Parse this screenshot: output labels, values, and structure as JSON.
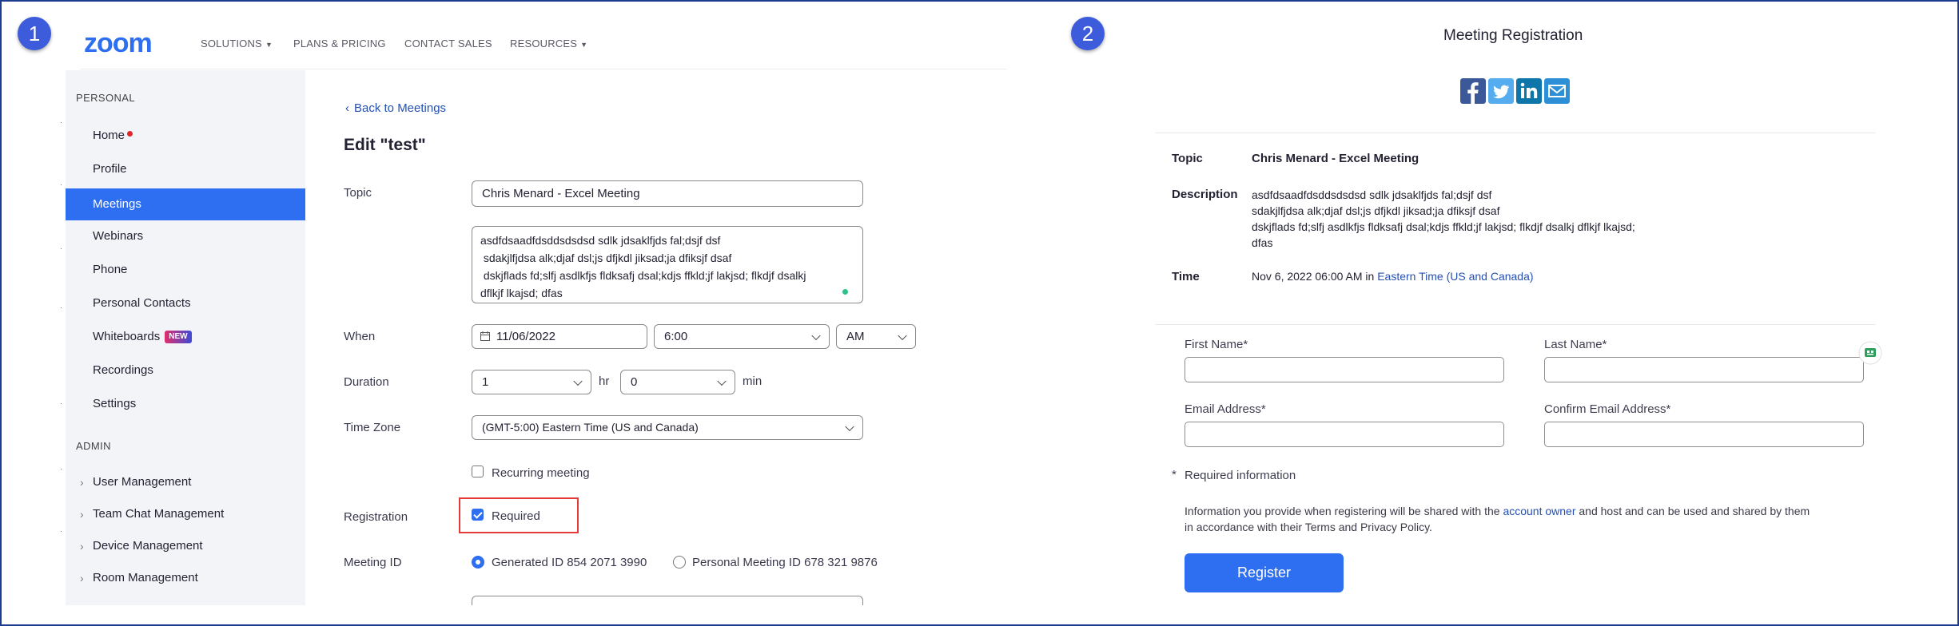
{
  "badges": {
    "one": "1",
    "two": "2"
  },
  "left": {
    "nav": {
      "solutions": "SOLUTIONS",
      "plans": "PLANS & PRICING",
      "contact": "CONTACT SALES",
      "resources": "RESOURCES"
    },
    "sidebar": {
      "personal_header": "PERSONAL",
      "items": [
        "Home",
        "Profile",
        "Meetings",
        "Webinars",
        "Phone",
        "Personal Contacts",
        "Whiteboards",
        "Recordings",
        "Settings"
      ],
      "new_tag": "NEW",
      "admin_header": "ADMIN",
      "admin_items": [
        "User Management",
        "Team Chat Management",
        "Device Management",
        "Room Management"
      ]
    },
    "back_link": "Back to Meetings",
    "title": "Edit \"test\"",
    "topic_label": "Topic",
    "topic_value": "Chris Menard - Excel Meeting",
    "description_lines": [
      "asdfdsaadfdsddsdsdsd sdlk jdsaklfjds fal;dsjf dsf",
      " sdakjlfjdsa alk;djaf dsl;js dfjkdl jiksad;ja dfiksjf dsaf",
      " dskjflads fd;slfj asdlkfjs fldksafj dsal;kdjs ffkld;jf lakjsd; flkdjf dsalkj",
      "dflkjf lkajsd; dfas"
    ],
    "when_label": "When",
    "date_value": "11/06/2022",
    "time_value": "6:00",
    "ampm_value": "AM",
    "duration_label": "Duration",
    "duration_hr": "1",
    "hr_unit": "hr",
    "duration_min": "0",
    "min_unit": "min",
    "timezone_label": "Time Zone",
    "timezone_value": "(GMT-5:00) Eastern Time (US and Canada)",
    "recurring_label": "Recurring meeting",
    "registration_label": "Registration",
    "required_label": "Required",
    "meeting_id_label": "Meeting ID",
    "generated_id": "Generated ID 854 2071 3990",
    "personal_id": "Personal Meeting ID 678 321 9876"
  },
  "right": {
    "title": "Meeting Registration",
    "topic_label": "Topic",
    "topic_value": "Chris Menard - Excel Meeting",
    "description_label": "Description",
    "description_lines": [
      "asdfdsaadfdsddsdsdsd sdlk jdsaklfjds fal;dsjf dsf",
      "sdakjlfjdsa alk;djaf dsl;js dfjkdl jiksad;ja dfiksjf dsaf",
      "dskjflads fd;slfj asdlkfjs fldksafj dsal;kdjs ffkld;jf lakjsd; flkdjf dsalkj dflkjf lkajsd;",
      "dfas"
    ],
    "time_label": "Time",
    "time_value": "Nov 6, 2022 06:00 AM in ",
    "time_zone_link": "Eastern Time (US and Canada)",
    "first_name_label": "First Name*",
    "last_name_label": "Last Name*",
    "email_label": "Email Address*",
    "confirm_email_label": "Confirm Email Address*",
    "required_star": "*",
    "required_info": "Required information",
    "disclaimer_pre": "Information you provide when registering will be shared with the ",
    "disclaimer_link": "account owner",
    "disclaimer_post": " and host and can be used and shared by them",
    "disclaimer_line2": "in accordance with their Terms and Privacy Policy.",
    "register_button": "Register"
  }
}
